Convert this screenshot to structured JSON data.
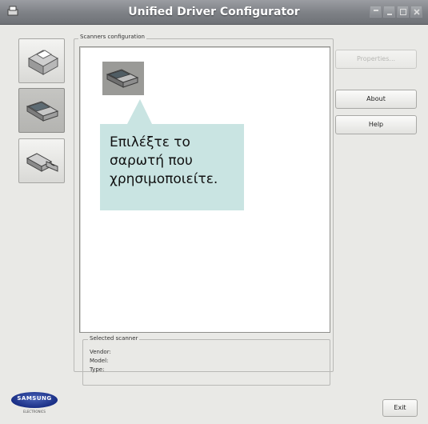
{
  "window": {
    "title": "Unified Driver Configurator"
  },
  "sidebar": {
    "items": [
      {
        "name": "printers-config",
        "icon": "printer-icon"
      },
      {
        "name": "scanners-config",
        "icon": "scanner-icon",
        "active": true
      },
      {
        "name": "ports-config",
        "icon": "port-icon"
      }
    ]
  },
  "main": {
    "group_label": "Scanners configuration",
    "callout_lines": [
      "Επιλέξτε το",
      "σαρωτή που",
      "χρησιμοποιείτε."
    ],
    "selected_scanner": {
      "label": "Selected scanner",
      "vendor_label": "Vendor:",
      "model_label": "Model:",
      "type_label": "Type:"
    }
  },
  "buttons": {
    "properties": "Properties...",
    "about": "About",
    "help": "Help",
    "exit": "Exit"
  },
  "logo": {
    "brand": "SAMSUNG",
    "sub": "ELECTRONICS"
  },
  "colors": {
    "window_bg": "#e9e9e6",
    "titlebar": "#7d8085",
    "callout_bg": "#c9e4e2",
    "logo_blue": "#1a2f86"
  }
}
